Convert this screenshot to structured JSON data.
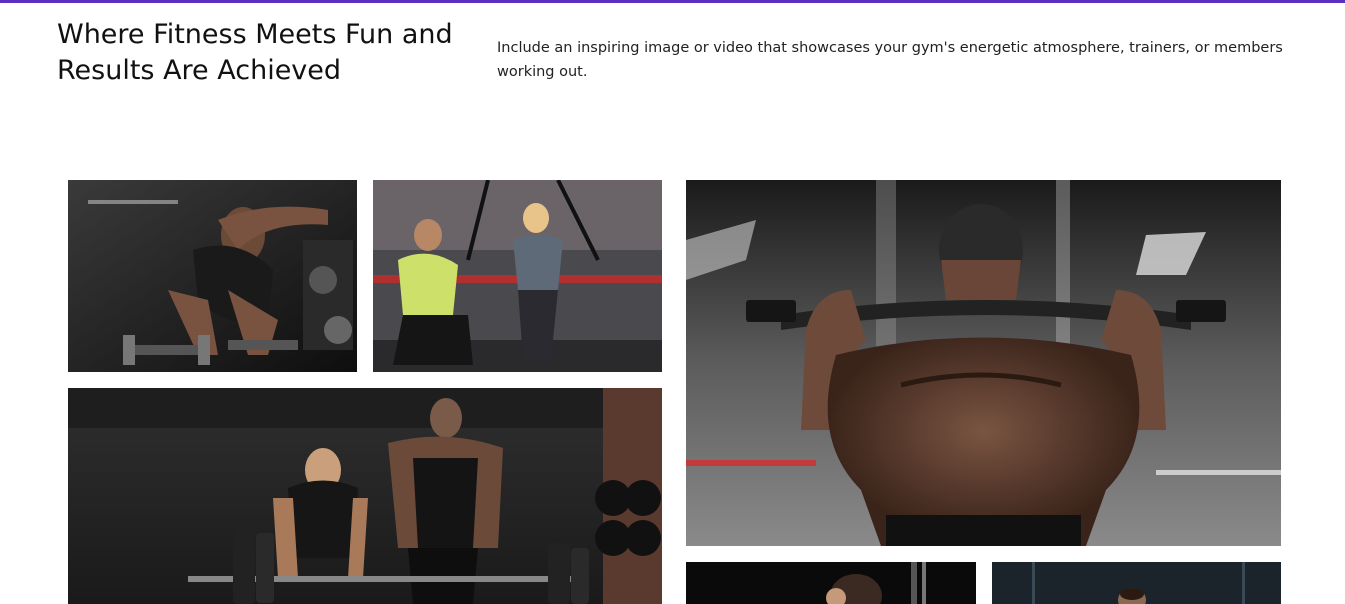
{
  "accent_color": "#5a2fc2",
  "hero": {
    "title": "Where Fitness Meets Fun and Results Are Achieved",
    "description": "Include an inspiring image or video that showcases your gym's energetic atmosphere, trainers, or members working out."
  },
  "gallery": {
    "images": [
      {
        "subject": "man-deadlifting-dumbbells-photo"
      },
      {
        "subject": "trainer-and-woman-suspension-training-photo"
      },
      {
        "subject": "woman-and-man-barbell-lift-photo"
      },
      {
        "subject": "man-lat-pulldown-back-tattoo-photo"
      },
      {
        "subject": "woman-in-gym-photo"
      },
      {
        "subject": "person-in-dark-gym-photo"
      }
    ]
  }
}
